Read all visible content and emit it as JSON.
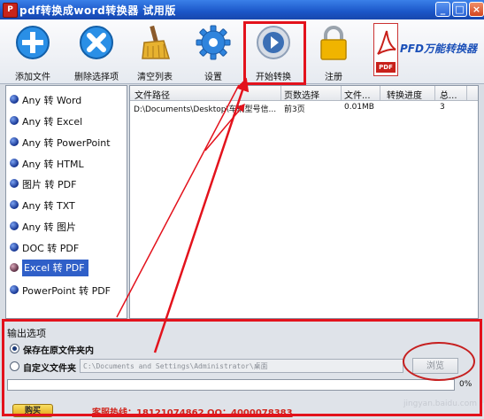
{
  "window": {
    "title": "pdf转换成word转换器 试用版",
    "icon_glyph": "P",
    "buttons": {
      "minimize": "_",
      "maximize": "□",
      "close": "×"
    }
  },
  "toolbar": {
    "items": [
      {
        "label": "添加文件",
        "icon": "plus-icon",
        "color": "#2a8fe6"
      },
      {
        "label": "删除选择项",
        "icon": "cross-icon",
        "color": "#2a8fe6"
      },
      {
        "label": "清空列表",
        "icon": "broom-icon",
        "color": "#d99a1e"
      },
      {
        "label": "设置",
        "icon": "gear-icon",
        "color": "#2f84dd"
      },
      {
        "label": "开始转换",
        "icon": "play-icon",
        "color": "#3b6fb5"
      },
      {
        "label": "注册",
        "icon": "lock-icon",
        "color": "#f0b400"
      }
    ],
    "brand": "PFD万能转换器",
    "brand_doc_label": "PDF"
  },
  "nav": {
    "items": [
      {
        "label": "Any 转 Word",
        "selected": false
      },
      {
        "label": "Any 转 Excel",
        "selected": false
      },
      {
        "label": "Any 转 PowerPoint",
        "selected": false
      },
      {
        "label": "Any 转 HTML",
        "selected": false
      },
      {
        "label": "图片 转 PDF",
        "selected": false
      },
      {
        "label": "Any 转 TXT",
        "selected": false
      },
      {
        "label": "Any 转 图片",
        "selected": false
      },
      {
        "label": "DOC 转 PDF",
        "selected": false
      },
      {
        "label": "Excel 转 PDF",
        "selected": true
      },
      {
        "label": "PowerPoint 转 PDF",
        "selected": false
      }
    ]
  },
  "table": {
    "columns": [
      "文件路径",
      "页数选择",
      "文件...",
      "转换进度",
      "总..."
    ],
    "rows": [
      {
        "path": "D:\\Documents\\Desktop\\车辆型号信...",
        "pages": "前3页",
        "size": "0.01MB",
        "progress": "",
        "total": "3"
      }
    ]
  },
  "output": {
    "legend": "输出选项",
    "option_same_folder": "保存在原文件夹内",
    "option_custom_folder": "自定义文件夹",
    "custom_path": "C:\\Documents and Settings\\Administrator\\桌面",
    "browse_label": "浏览",
    "progress_percent": 0,
    "progress_text": "0%"
  },
  "footer": {
    "buy_label": "购买",
    "contact": "客服热线：18121074862  QQ：4000078383"
  },
  "watermark": "jingyan.baidu.com",
  "colors": {
    "annotation": "#e3121c",
    "selection": "#2f5fc8",
    "titlebar": "#1b56c8"
  }
}
